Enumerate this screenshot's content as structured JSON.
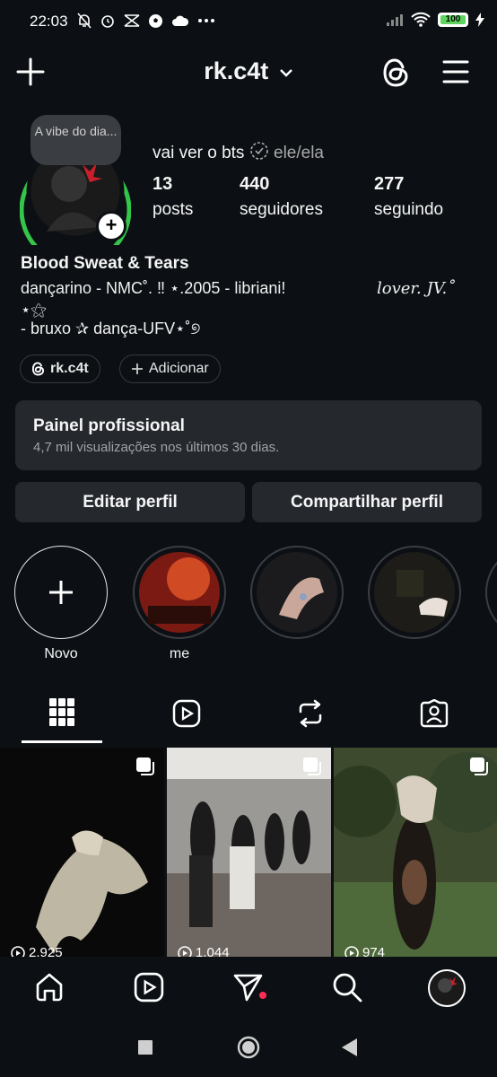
{
  "status_bar": {
    "time": "22:03",
    "battery": "100"
  },
  "header": {
    "username": "rk.c4t"
  },
  "profile": {
    "note": "A vibe do dia...",
    "display_name": "vai ver o bts",
    "pronouns": "ele/ela",
    "stats": [
      {
        "value": "13",
        "label": "posts"
      },
      {
        "value": "440",
        "label": "seguidores"
      },
      {
        "value": "277",
        "label": "seguindo"
      }
    ],
    "bio_title": "Blood Sweat & Tears",
    "bio_line1": "dançarino - NMC˚. ‼  ⋆.2005  - libriani!",
    "bio_line1_right": "lover. JV.˚",
    "bio_line2": "⋆⚝",
    "bio_line3": "- bruxo ✰ dança-UFV⋆˚୭"
  },
  "chips": {
    "threads": "rk.c4t",
    "add": "Adicionar"
  },
  "pro_panel": {
    "title": "Painel profissional",
    "subtitle": "4,7 mil visualizações nos últimos 30 dias."
  },
  "buttons": {
    "edit": "Editar perfil",
    "share": "Compartilhar perfil"
  },
  "highlights": [
    {
      "label": "Novo"
    },
    {
      "label": "me"
    },
    {
      "label": ""
    },
    {
      "label": ""
    }
  ],
  "grid": [
    {
      "views": "2.925"
    },
    {
      "views": "1.044"
    },
    {
      "views": "974"
    }
  ]
}
